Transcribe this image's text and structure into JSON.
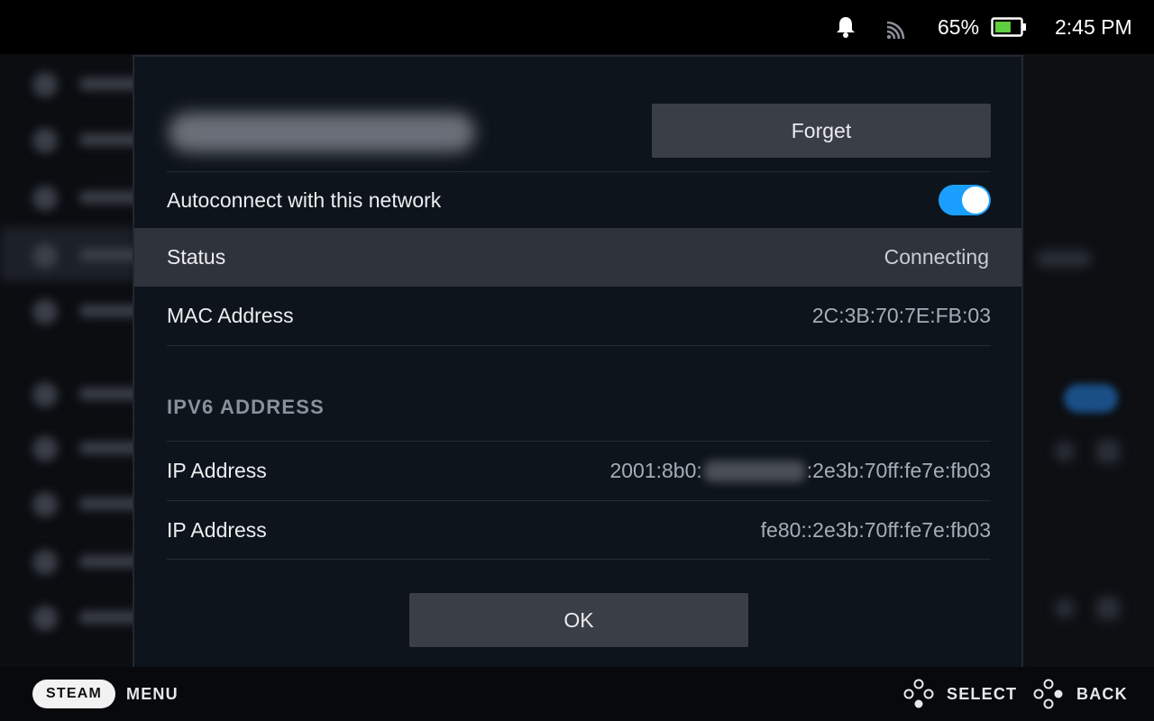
{
  "status_bar": {
    "battery_percent": "65%",
    "battery_level": 0.65,
    "time": "2:45 PM",
    "icons": [
      "bell-icon",
      "wifi-icon",
      "battery-icon"
    ]
  },
  "modal": {
    "forget_label": "Forget",
    "autoconnect": {
      "label": "Autoconnect with this network",
      "enabled": true
    },
    "status": {
      "label": "Status",
      "value": "Connecting"
    },
    "mac": {
      "label": "MAC Address",
      "value": "2C:3B:70:7E:FB:03"
    },
    "ipv6_header": "IPV6 ADDRESS",
    "ip_rows": [
      {
        "label": "IP Address",
        "prefix": "2001:8b0:",
        "suffix": ":2e3b:70ff:fe7e:fb03"
      },
      {
        "label": "IP Address",
        "value": "fe80::2e3b:70ff:fe7e:fb03"
      }
    ],
    "ok_label": "OK"
  },
  "footer": {
    "steam_label": "STEAM",
    "menu_label": "MENU",
    "select_label": "SELECT",
    "back_label": "BACK"
  },
  "colors": {
    "accent": "#1a9fff",
    "modal_bg": "#0e141b",
    "button_bg": "#3a3e46",
    "highlight_row": "#2f333b"
  }
}
